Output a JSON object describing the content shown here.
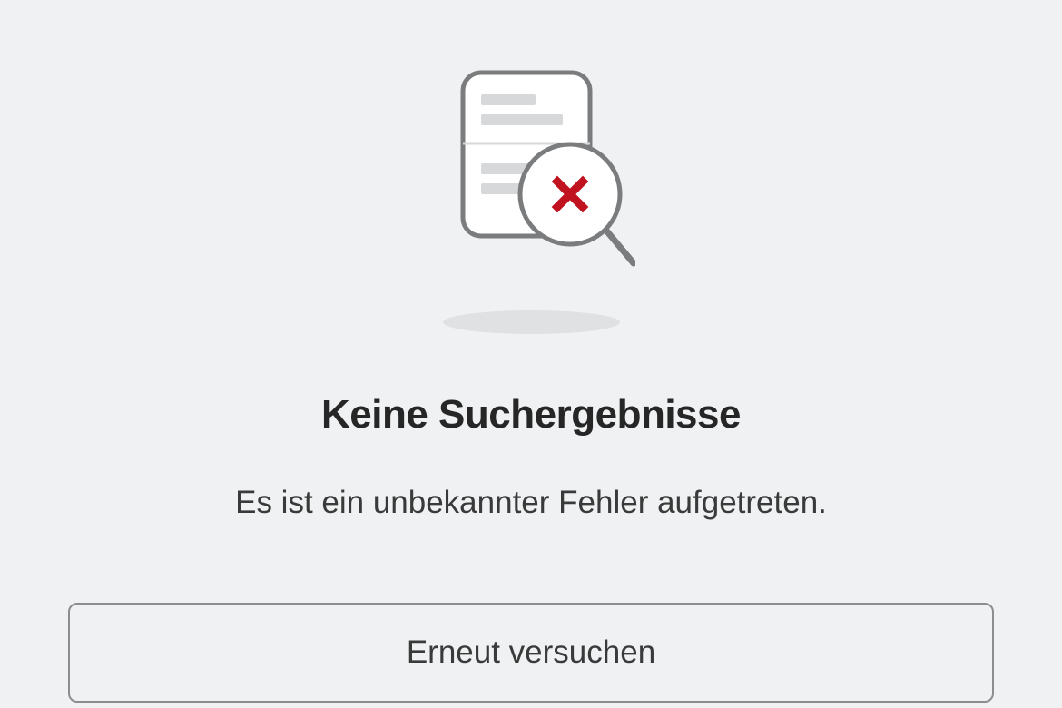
{
  "empty_state": {
    "heading": "Keine Suchergebnisse",
    "message": "Es ist ein unbekannter Fehler aufgetreten.",
    "retry_label": "Erneut versuchen"
  },
  "colors": {
    "accent_error": "#c1121f",
    "icon_stroke": "#7a7c7e",
    "icon_fill_bar": "#d6d8da"
  }
}
